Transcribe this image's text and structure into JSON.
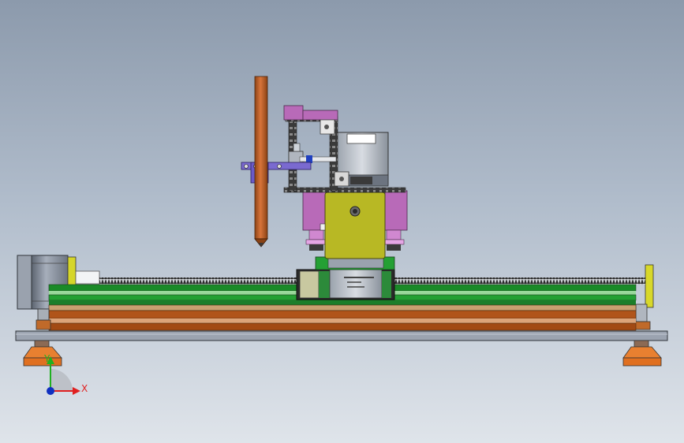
{
  "viewport": {
    "background_top": "#8c9aac",
    "background_bottom": "#dfe4ea"
  },
  "triad": {
    "x_label": "X",
    "y_label": "Y",
    "x_color": "#e02020",
    "y_color": "#20b020",
    "z_color": "#1030c0"
  },
  "colors": {
    "rail_green": "#1e9a2e",
    "rail_orange": "#b0541a",
    "base_plate": "#9098a6",
    "foot": "#e07828",
    "carriage_yellow": "#b8b824",
    "bracket_magenta": "#b86ab8",
    "bracket_purple": "#7a6ad0",
    "pen_orange": "#c0622a",
    "motor_grey": "#808896",
    "end_plate_yellow": "#d8d82a"
  }
}
